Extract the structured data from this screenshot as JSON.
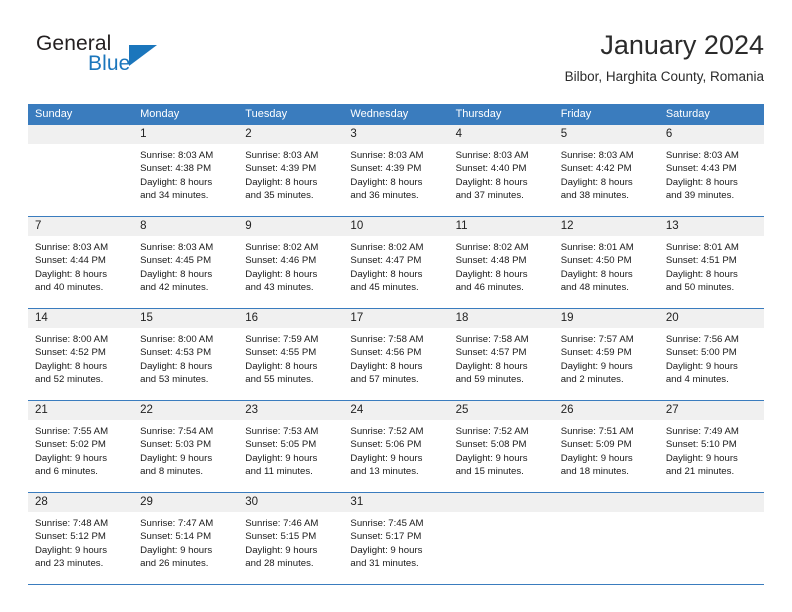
{
  "brand": {
    "name_top": "General",
    "name_bottom": "Blue",
    "triangle_icon": "triangle-icon",
    "color_dark": "#231f20",
    "color_blue": "#1b76bc"
  },
  "header": {
    "title": "January 2024",
    "subtitle": "Bilbor, Harghita County, Romania"
  },
  "theme": {
    "header_bar": "#3a7cbe",
    "daynum_band": "#f0f0f0",
    "row_divider": "#3a7cbe"
  },
  "weekdays": [
    "Sunday",
    "Monday",
    "Tuesday",
    "Wednesday",
    "Thursday",
    "Friday",
    "Saturday"
  ],
  "weeks": [
    [
      {
        "day": "",
        "lines": []
      },
      {
        "day": "1",
        "lines": [
          "Sunrise: 8:03 AM",
          "Sunset: 4:38 PM",
          "Daylight: 8 hours",
          "and 34 minutes."
        ]
      },
      {
        "day": "2",
        "lines": [
          "Sunrise: 8:03 AM",
          "Sunset: 4:39 PM",
          "Daylight: 8 hours",
          "and 35 minutes."
        ]
      },
      {
        "day": "3",
        "lines": [
          "Sunrise: 8:03 AM",
          "Sunset: 4:39 PM",
          "Daylight: 8 hours",
          "and 36 minutes."
        ]
      },
      {
        "day": "4",
        "lines": [
          "Sunrise: 8:03 AM",
          "Sunset: 4:40 PM",
          "Daylight: 8 hours",
          "and 37 minutes."
        ]
      },
      {
        "day": "5",
        "lines": [
          "Sunrise: 8:03 AM",
          "Sunset: 4:42 PM",
          "Daylight: 8 hours",
          "and 38 minutes."
        ]
      },
      {
        "day": "6",
        "lines": [
          "Sunrise: 8:03 AM",
          "Sunset: 4:43 PM",
          "Daylight: 8 hours",
          "and 39 minutes."
        ]
      }
    ],
    [
      {
        "day": "7",
        "lines": [
          "Sunrise: 8:03 AM",
          "Sunset: 4:44 PM",
          "Daylight: 8 hours",
          "and 40 minutes."
        ]
      },
      {
        "day": "8",
        "lines": [
          "Sunrise: 8:03 AM",
          "Sunset: 4:45 PM",
          "Daylight: 8 hours",
          "and 42 minutes."
        ]
      },
      {
        "day": "9",
        "lines": [
          "Sunrise: 8:02 AM",
          "Sunset: 4:46 PM",
          "Daylight: 8 hours",
          "and 43 minutes."
        ]
      },
      {
        "day": "10",
        "lines": [
          "Sunrise: 8:02 AM",
          "Sunset: 4:47 PM",
          "Daylight: 8 hours",
          "and 45 minutes."
        ]
      },
      {
        "day": "11",
        "lines": [
          "Sunrise: 8:02 AM",
          "Sunset: 4:48 PM",
          "Daylight: 8 hours",
          "and 46 minutes."
        ]
      },
      {
        "day": "12",
        "lines": [
          "Sunrise: 8:01 AM",
          "Sunset: 4:50 PM",
          "Daylight: 8 hours",
          "and 48 minutes."
        ]
      },
      {
        "day": "13",
        "lines": [
          "Sunrise: 8:01 AM",
          "Sunset: 4:51 PM",
          "Daylight: 8 hours",
          "and 50 minutes."
        ]
      }
    ],
    [
      {
        "day": "14",
        "lines": [
          "Sunrise: 8:00 AM",
          "Sunset: 4:52 PM",
          "Daylight: 8 hours",
          "and 52 minutes."
        ]
      },
      {
        "day": "15",
        "lines": [
          "Sunrise: 8:00 AM",
          "Sunset: 4:53 PM",
          "Daylight: 8 hours",
          "and 53 minutes."
        ]
      },
      {
        "day": "16",
        "lines": [
          "Sunrise: 7:59 AM",
          "Sunset: 4:55 PM",
          "Daylight: 8 hours",
          "and 55 minutes."
        ]
      },
      {
        "day": "17",
        "lines": [
          "Sunrise: 7:58 AM",
          "Sunset: 4:56 PM",
          "Daylight: 8 hours",
          "and 57 minutes."
        ]
      },
      {
        "day": "18",
        "lines": [
          "Sunrise: 7:58 AM",
          "Sunset: 4:57 PM",
          "Daylight: 8 hours",
          "and 59 minutes."
        ]
      },
      {
        "day": "19",
        "lines": [
          "Sunrise: 7:57 AM",
          "Sunset: 4:59 PM",
          "Daylight: 9 hours",
          "and 2 minutes."
        ]
      },
      {
        "day": "20",
        "lines": [
          "Sunrise: 7:56 AM",
          "Sunset: 5:00 PM",
          "Daylight: 9 hours",
          "and 4 minutes."
        ]
      }
    ],
    [
      {
        "day": "21",
        "lines": [
          "Sunrise: 7:55 AM",
          "Sunset: 5:02 PM",
          "Daylight: 9 hours",
          "and 6 minutes."
        ]
      },
      {
        "day": "22",
        "lines": [
          "Sunrise: 7:54 AM",
          "Sunset: 5:03 PM",
          "Daylight: 9 hours",
          "and 8 minutes."
        ]
      },
      {
        "day": "23",
        "lines": [
          "Sunrise: 7:53 AM",
          "Sunset: 5:05 PM",
          "Daylight: 9 hours",
          "and 11 minutes."
        ]
      },
      {
        "day": "24",
        "lines": [
          "Sunrise: 7:52 AM",
          "Sunset: 5:06 PM",
          "Daylight: 9 hours",
          "and 13 minutes."
        ]
      },
      {
        "day": "25",
        "lines": [
          "Sunrise: 7:52 AM",
          "Sunset: 5:08 PM",
          "Daylight: 9 hours",
          "and 15 minutes."
        ]
      },
      {
        "day": "26",
        "lines": [
          "Sunrise: 7:51 AM",
          "Sunset: 5:09 PM",
          "Daylight: 9 hours",
          "and 18 minutes."
        ]
      },
      {
        "day": "27",
        "lines": [
          "Sunrise: 7:49 AM",
          "Sunset: 5:10 PM",
          "Daylight: 9 hours",
          "and 21 minutes."
        ]
      }
    ],
    [
      {
        "day": "28",
        "lines": [
          "Sunrise: 7:48 AM",
          "Sunset: 5:12 PM",
          "Daylight: 9 hours",
          "and 23 minutes."
        ]
      },
      {
        "day": "29",
        "lines": [
          "Sunrise: 7:47 AM",
          "Sunset: 5:14 PM",
          "Daylight: 9 hours",
          "and 26 minutes."
        ]
      },
      {
        "day": "30",
        "lines": [
          "Sunrise: 7:46 AM",
          "Sunset: 5:15 PM",
          "Daylight: 9 hours",
          "and 28 minutes."
        ]
      },
      {
        "day": "31",
        "lines": [
          "Sunrise: 7:45 AM",
          "Sunset: 5:17 PM",
          "Daylight: 9 hours",
          "and 31 minutes."
        ]
      },
      {
        "day": "",
        "lines": []
      },
      {
        "day": "",
        "lines": []
      },
      {
        "day": "",
        "lines": []
      }
    ]
  ]
}
